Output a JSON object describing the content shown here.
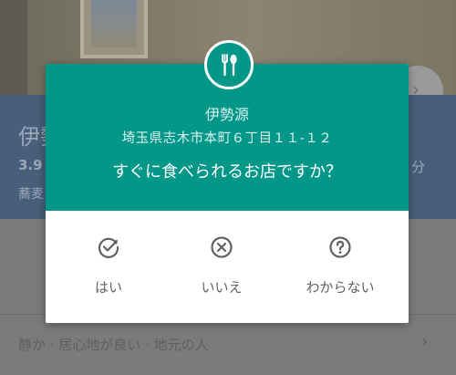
{
  "background": {
    "place_title": "伊勢",
    "rating": "3.9",
    "category": "蕎麦",
    "duration": "分",
    "tags": "静か · 居心地が良い · 地元の人",
    "chevron": "›"
  },
  "dialog": {
    "icon": "restaurant-icon",
    "place_name": "伊勢源",
    "address": "埼玉県志木市本町６丁目１１-１２",
    "question": "すぐに食べられるお店ですか？",
    "choices": [
      {
        "label": "はい",
        "icon": "check-circle-icon"
      },
      {
        "label": "いいえ",
        "icon": "x-circle-icon"
      },
      {
        "label": "わからない",
        "icon": "question-circle-icon"
      }
    ]
  },
  "colors": {
    "accent": "#009688",
    "header_bg": "#475f7a",
    "choice_text": "#616161"
  }
}
